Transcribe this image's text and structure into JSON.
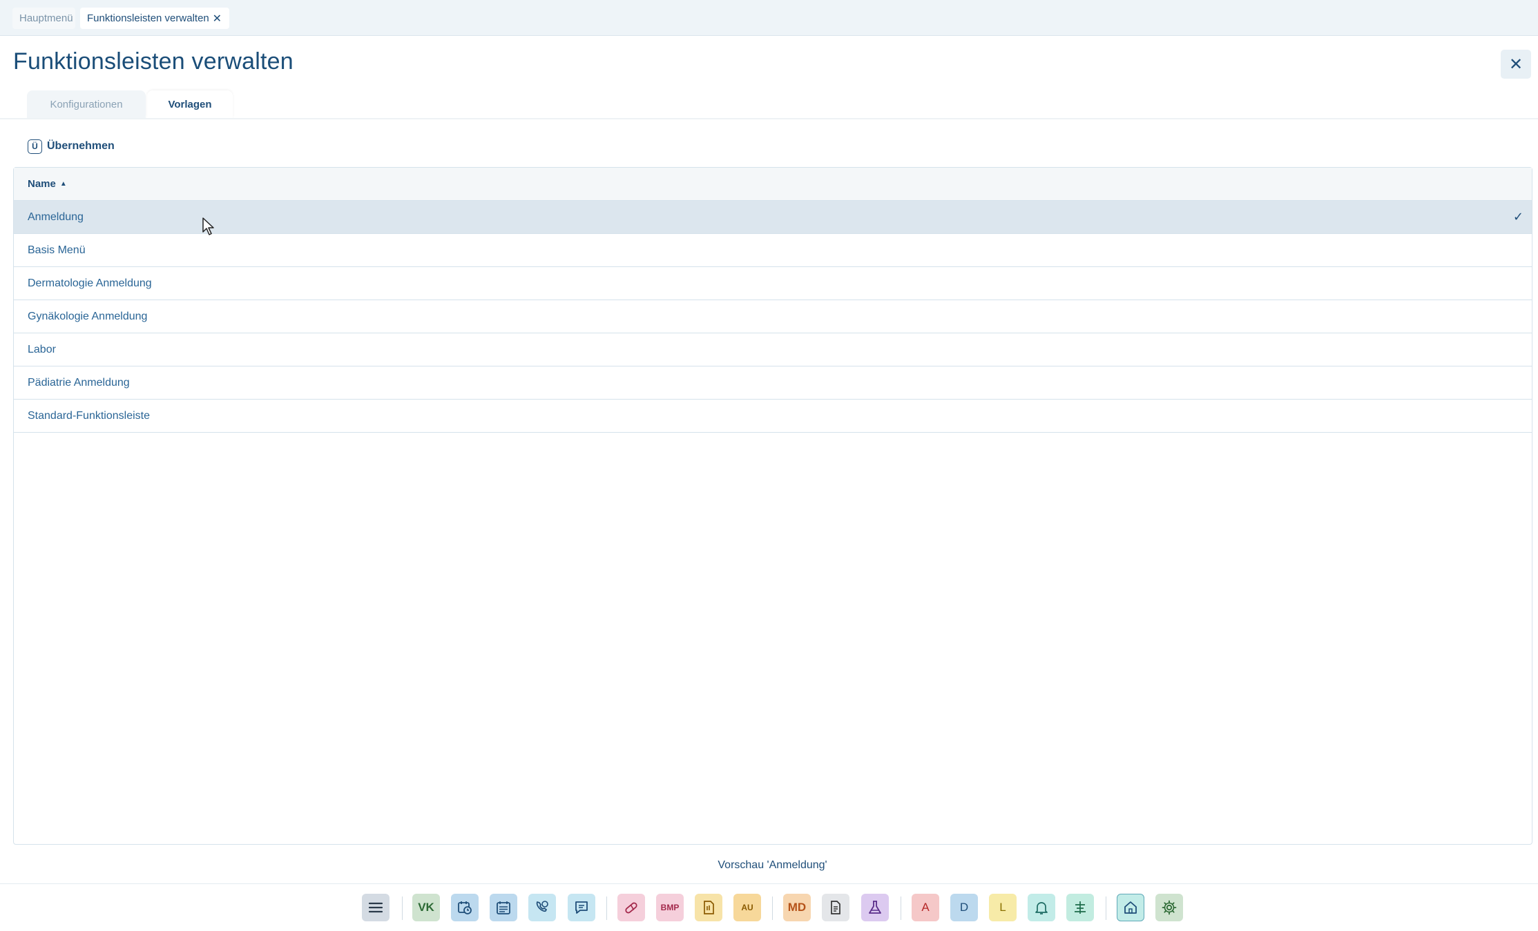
{
  "top_tabs": [
    {
      "label": "Hauptmenü"
    },
    {
      "label": "Funktionsleisten verwalten"
    }
  ],
  "page": {
    "title": "Funktionsleisten verwalten"
  },
  "tabs": [
    {
      "label": "Konfigurationen"
    },
    {
      "label": "Vorlagen"
    }
  ],
  "actions": {
    "uebernehmen_icon": "Ü",
    "uebernehmen_label": "Übernehmen"
  },
  "table": {
    "header": "Name",
    "rows": [
      {
        "name": "Anmeldung",
        "selected": true
      },
      {
        "name": "Basis Menü"
      },
      {
        "name": "Dermatologie Anmeldung"
      },
      {
        "name": "Gynäkologie Anmeldung"
      },
      {
        "name": "Labor"
      },
      {
        "name": "Pädiatrie Anmeldung"
      },
      {
        "name": "Standard-Funktionsleiste"
      }
    ]
  },
  "preview": {
    "label": "Vorschau 'Anmeldung'"
  },
  "toolbar": {
    "vk": "VK",
    "bmp": "BMP",
    "au": "AU",
    "md": "MD",
    "a": "A",
    "d": "D",
    "l": "L"
  },
  "colors": {
    "primary": "#1f4e79",
    "selected_row": "#dce6ee"
  }
}
